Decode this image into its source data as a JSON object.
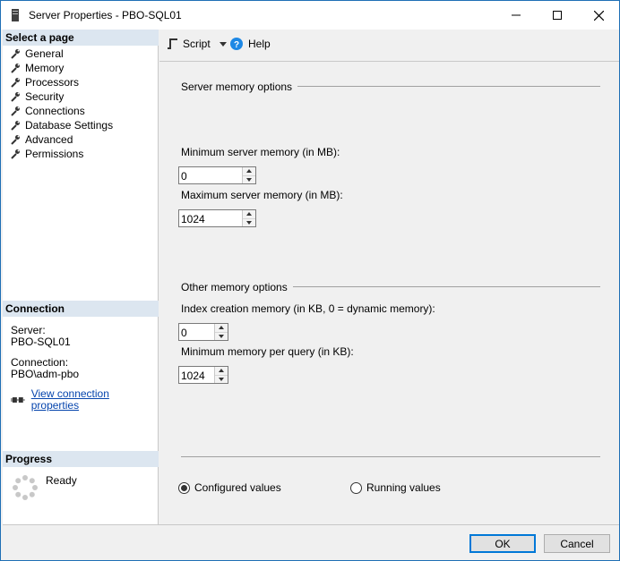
{
  "window": {
    "title": "Server Properties - PBO-SQL01"
  },
  "left": {
    "select_page_header": "Select a page",
    "pages": [
      {
        "label": "General"
      },
      {
        "label": "Memory"
      },
      {
        "label": "Processors"
      },
      {
        "label": "Security"
      },
      {
        "label": "Connections"
      },
      {
        "label": "Database Settings"
      },
      {
        "label": "Advanced"
      },
      {
        "label": "Permissions"
      }
    ],
    "connection_header": "Connection",
    "server_label": "Server:",
    "server_value": "PBO-SQL01",
    "connection_label": "Connection:",
    "connection_value": "PBO\\adm-pbo",
    "view_connection_link": "View connection properties",
    "progress_header": "Progress",
    "progress_status": "Ready"
  },
  "toolbar": {
    "script_label": "Script",
    "help_label": "Help"
  },
  "memory": {
    "server_memory_group": "Server memory options",
    "min_server_label": "Minimum server memory (in MB):",
    "min_server_value": "0",
    "max_server_label": "Maximum server memory (in MB):",
    "max_server_value": "1024",
    "other_memory_group": "Other memory options",
    "index_creation_label": "Index creation memory (in KB, 0 = dynamic memory):",
    "index_creation_value": "0",
    "min_query_label": "Minimum memory per query (in KB):",
    "min_query_value": "1024",
    "configured_values_label": "Configured values",
    "running_values_label": "Running values",
    "selected_mode": "configured"
  },
  "footer": {
    "ok_label": "OK",
    "cancel_label": "Cancel"
  },
  "colors": {
    "accent": "#0078d7",
    "section_header_bg": "#dce6f0",
    "link": "#0645ad"
  }
}
